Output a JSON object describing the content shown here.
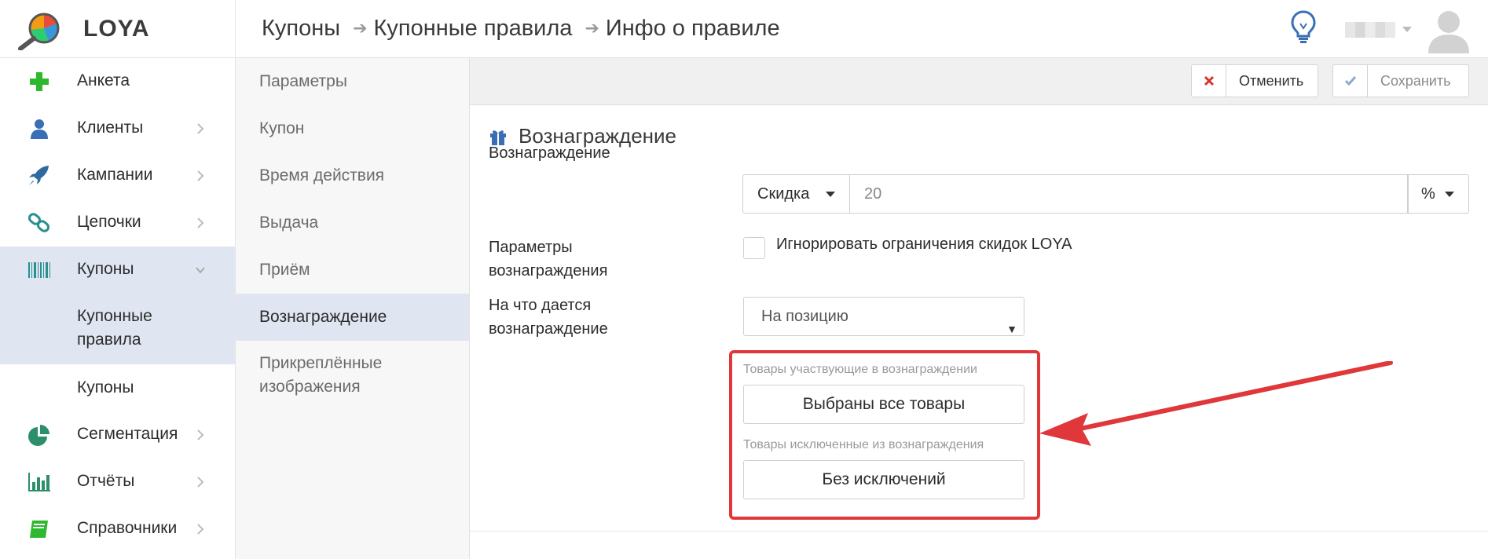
{
  "app": {
    "name": "LOYA"
  },
  "breadcrumb": [
    "Купоны",
    "Купонные правила",
    "Инфо о правиле"
  ],
  "sidebar": {
    "items": [
      {
        "label": "Анкета",
        "icon": "plus-icon"
      },
      {
        "label": "Клиенты",
        "icon": "user-icon"
      },
      {
        "label": "Кампании",
        "icon": "rocket-icon"
      },
      {
        "label": "Цепочки",
        "icon": "link-icon"
      },
      {
        "label": "Купоны",
        "icon": "barcode-icon"
      },
      {
        "label": "Сегментация",
        "icon": "pie-icon"
      },
      {
        "label": "Отчёты",
        "icon": "bar-chart-icon"
      },
      {
        "label": "Справочники",
        "icon": "book-icon"
      }
    ],
    "sub_items": [
      "Купонные правила",
      "Купоны"
    ]
  },
  "subnav": {
    "items": [
      "Параметры",
      "Купон",
      "Время действия",
      "Выдача",
      "Приём",
      "Вознаграждение",
      "Прикреплённые изображения"
    ],
    "active": "Вознаграждение"
  },
  "toolbar": {
    "cancel_label": "Отменить",
    "save_label": "Сохранить"
  },
  "section": {
    "title": "Вознаграждение",
    "reward_label": "Вознаграждение",
    "reward_type": "Скидка",
    "reward_value": "20",
    "reward_unit": "%",
    "params_label": "Параметры вознаграждения",
    "ignore_limits_label": "Игнорировать ограничения скидок LOYA",
    "target_label": "На что дается вознаграждение",
    "target_value": "На позицию",
    "included_goods_label": "Товары участвующие в вознаграждении",
    "included_goods_button": "Выбраны все товары",
    "excluded_goods_label": "Товары исключенные из вознаграждения",
    "excluded_goods_button": "Без исключений"
  },
  "colors": {
    "accent_green": "#2eb82e",
    "accent_blue": "#3a6fb5",
    "active_bg": "#dfe6f1",
    "highlight_red": "#e0373a"
  }
}
